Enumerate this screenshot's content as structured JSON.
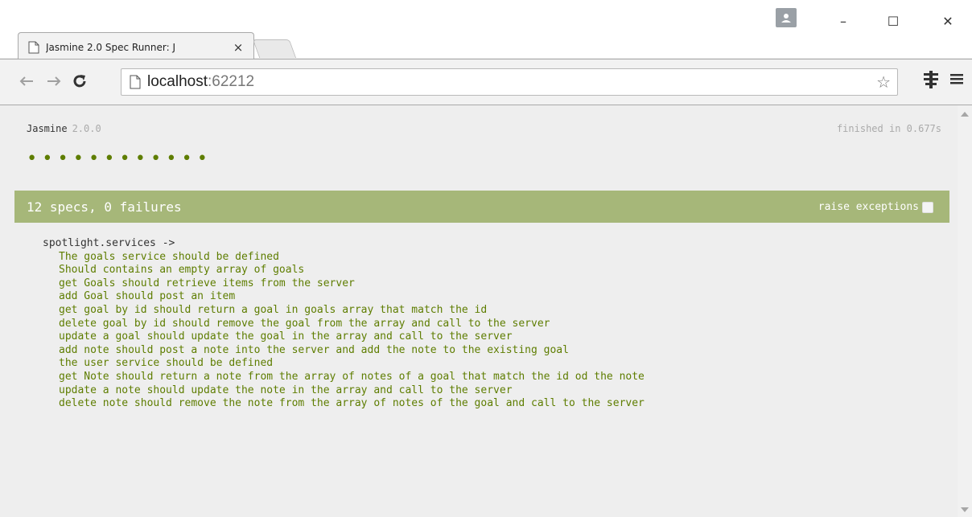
{
  "window": {
    "tab_title": "Jasmine 2.0 Spec Runner: J",
    "close_label": "×",
    "minimize_label": "–",
    "maximize_label": "☐",
    "window_close_label": "✕"
  },
  "toolbar": {
    "back_icon": "back-arrow-icon",
    "forward_icon": "forward-arrow-icon",
    "reload_icon": "reload-icon",
    "url_host": "localhost",
    "url_port": ":62212"
  },
  "runner": {
    "name": "Jasmine",
    "version": "2.0.0",
    "duration": "finished in 0.677s",
    "summary": "12 specs, 0 failures",
    "raise_exceptions_label": "raise exceptions",
    "raise_exceptions_checked": false,
    "dot_count": 12,
    "accent_color": "#a6b779",
    "pass_color": "#5e7d00"
  },
  "suite": {
    "name": "spotlight.services ->",
    "specs": [
      "The goals service should be defined",
      "Should contains an empty array of goals",
      "get Goals should retrieve items from the server",
      "add Goal should post an item",
      "get goal by id should return a goal in goals array that match the id",
      "delete goal by id should remove the goal from the array and call to the server",
      "update a goal should update the goal in the array and call to the server",
      "add note should post a note into the server and add the note to the existing goal",
      "the user service should be defined",
      "get Note should return a note from the array of notes of a goal that match the id od the note",
      "update a note should update the note in the array and call to the server",
      "delete note should remove the note from the array of notes of the goal and call to the server"
    ]
  }
}
